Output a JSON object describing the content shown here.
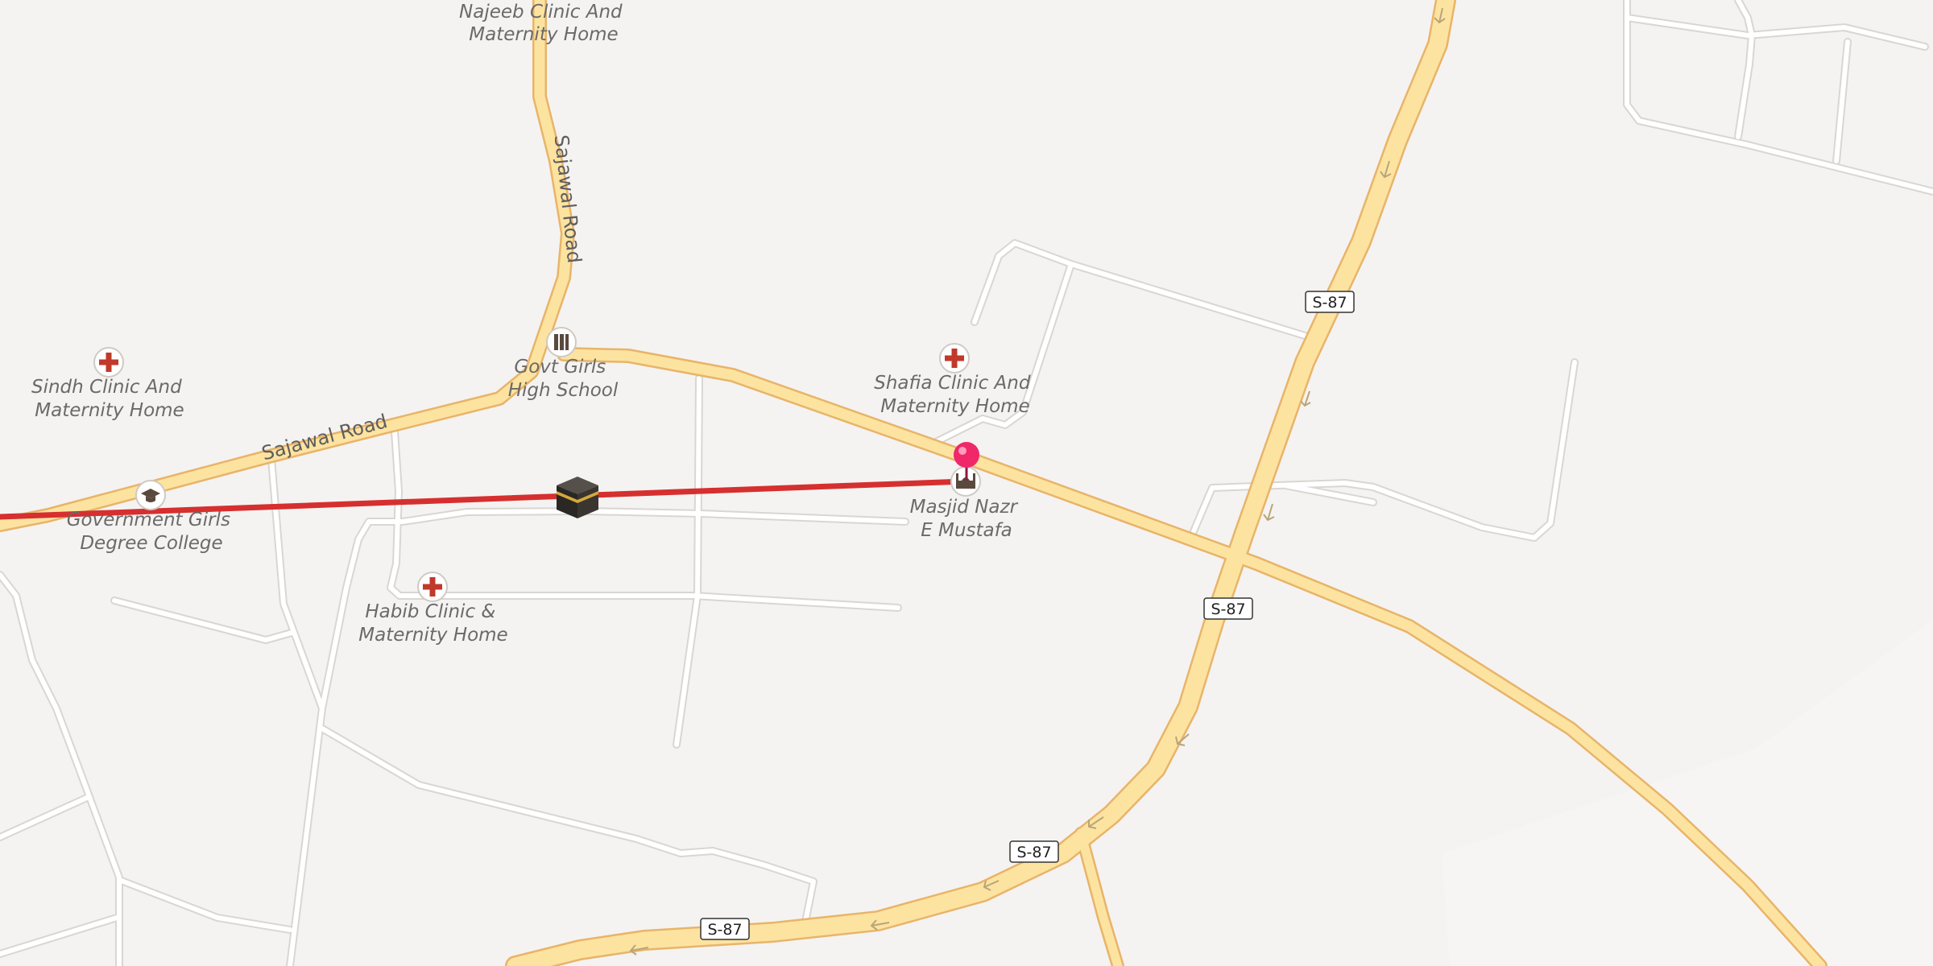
{
  "colors": {
    "background": "#f5f3f1",
    "minor_road": "#ffffff",
    "minor_road_casing": "#d9d6d2",
    "major_road": "#fde3a0",
    "major_road_casing": "#e8b46a",
    "route_line": "#d62f2f",
    "pin": "#f0276a",
    "hospital_cross": "#c0392b",
    "label": "#6a6a6a"
  },
  "roads": {
    "sajawal_road_1": "Sajawal Road",
    "sajawal_road_2": "Sajawal Road",
    "highway_shields": [
      "S-87",
      "S-87",
      "S-87",
      "S-87"
    ]
  },
  "places": {
    "najeeb_clinic": [
      "Najeeb Clinic And",
      "Maternity Home"
    ],
    "sindh_clinic": [
      "Sindh Clinic And",
      "Maternity Home"
    ],
    "govt_girls_school": [
      "Govt Girls",
      "High School"
    ],
    "government_girls_college": [
      "Government Girls",
      "Degree College"
    ],
    "habib_clinic": [
      "Habib Clinic &",
      "Maternity Home"
    ],
    "shafia_clinic": [
      "Shafia Clinic And",
      "Maternity Home"
    ],
    "masjid_nazr": [
      "Masjid Nazr",
      "E Mustafa"
    ]
  },
  "icons": {
    "hospital": "hospital-cross-icon",
    "school": "school-icon",
    "college": "graduation-cap-icon",
    "mosque": "mosque-icon",
    "kaaba": "kaaba-icon",
    "pin": "location-pin-icon"
  }
}
